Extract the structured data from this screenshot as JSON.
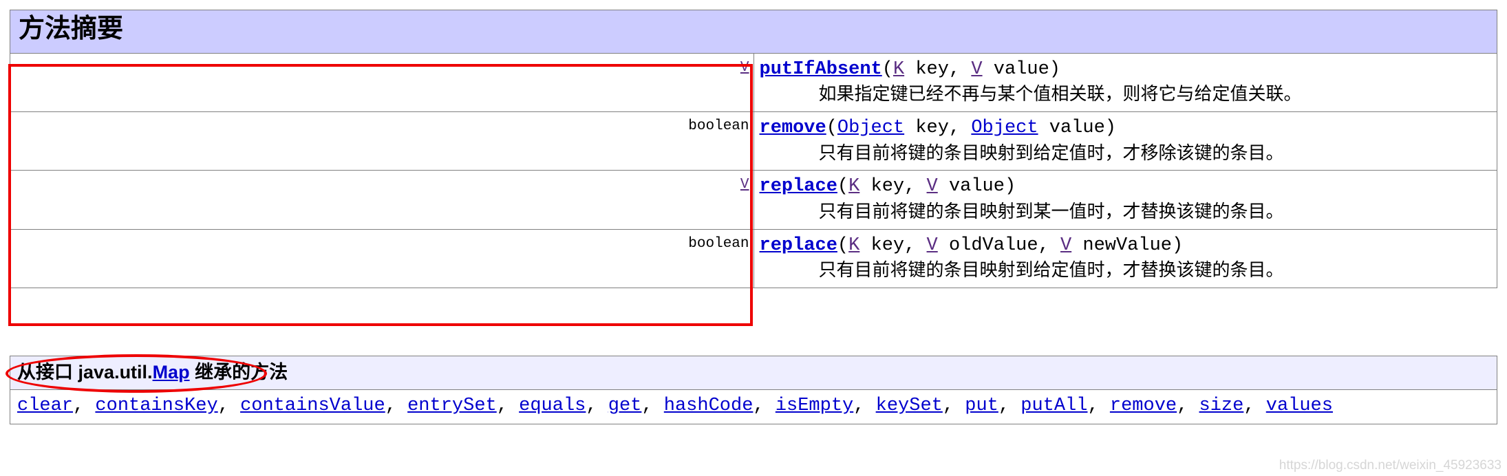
{
  "method_summary": {
    "title": "方法摘要",
    "rows": [
      {
        "return_type": "V",
        "return_type_is_link": true,
        "method_name": "putIfAbsent",
        "signature_parts": [
          {
            "text": "(",
            "kind": "plain"
          },
          {
            "text": "K",
            "kind": "generic"
          },
          {
            "text": " key, ",
            "kind": "plain"
          },
          {
            "text": "V",
            "kind": "generic"
          },
          {
            "text": " value)",
            "kind": "plain"
          }
        ],
        "description": "如果指定键已经不再与某个值相关联，则将它与给定值关联。"
      },
      {
        "return_type": "boolean",
        "return_type_is_link": false,
        "method_name": "remove",
        "signature_parts": [
          {
            "text": "(",
            "kind": "plain"
          },
          {
            "text": "Object",
            "kind": "type-link"
          },
          {
            "text": " key, ",
            "kind": "plain"
          },
          {
            "text": "Object",
            "kind": "type-link"
          },
          {
            "text": " value)",
            "kind": "plain"
          }
        ],
        "description": "只有目前将键的条目映射到给定值时，才移除该键的条目。"
      },
      {
        "return_type": "V",
        "return_type_is_link": true,
        "method_name": "replace",
        "signature_parts": [
          {
            "text": "(",
            "kind": "plain"
          },
          {
            "text": "K",
            "kind": "generic"
          },
          {
            "text": " key, ",
            "kind": "plain"
          },
          {
            "text": "V",
            "kind": "generic"
          },
          {
            "text": " value)",
            "kind": "plain"
          }
        ],
        "description": "只有目前将键的条目映射到某一值时，才替换该键的条目。"
      },
      {
        "return_type": "boolean",
        "return_type_is_link": false,
        "method_name": "replace",
        "signature_parts": [
          {
            "text": "(",
            "kind": "plain"
          },
          {
            "text": "K",
            "kind": "generic"
          },
          {
            "text": " key, ",
            "kind": "plain"
          },
          {
            "text": "V",
            "kind": "generic"
          },
          {
            "text": " oldValue, ",
            "kind": "plain"
          },
          {
            "text": "V",
            "kind": "generic"
          },
          {
            "text": " newValue)",
            "kind": "plain"
          }
        ],
        "description": "只有目前将键的条目映射到给定值时，才替换该键的条目。"
      }
    ]
  },
  "inherited": {
    "header_prefix": "从接口 ",
    "header_package": "java.util.",
    "header_link": "Map",
    "header_suffix": " 继承的方法",
    "methods": [
      "clear",
      "containsKey",
      "containsValue",
      "entrySet",
      "equals",
      "get",
      "hashCode",
      "isEmpty",
      "keySet",
      "put",
      "putAll",
      "remove",
      "size",
      "values"
    ],
    "separator": ", "
  },
  "annotations": {
    "rectangle_color": "#ee0000",
    "ellipse_color": "#ee0000"
  },
  "watermark": "https://blog.csdn.net/weixin_45923633",
  "colors": {
    "summary_header_bg": "#ccccff",
    "inherited_header_bg": "#eeeeff",
    "link": "#0000cd",
    "generic_param": "#5a2d82",
    "border": "#808080"
  }
}
